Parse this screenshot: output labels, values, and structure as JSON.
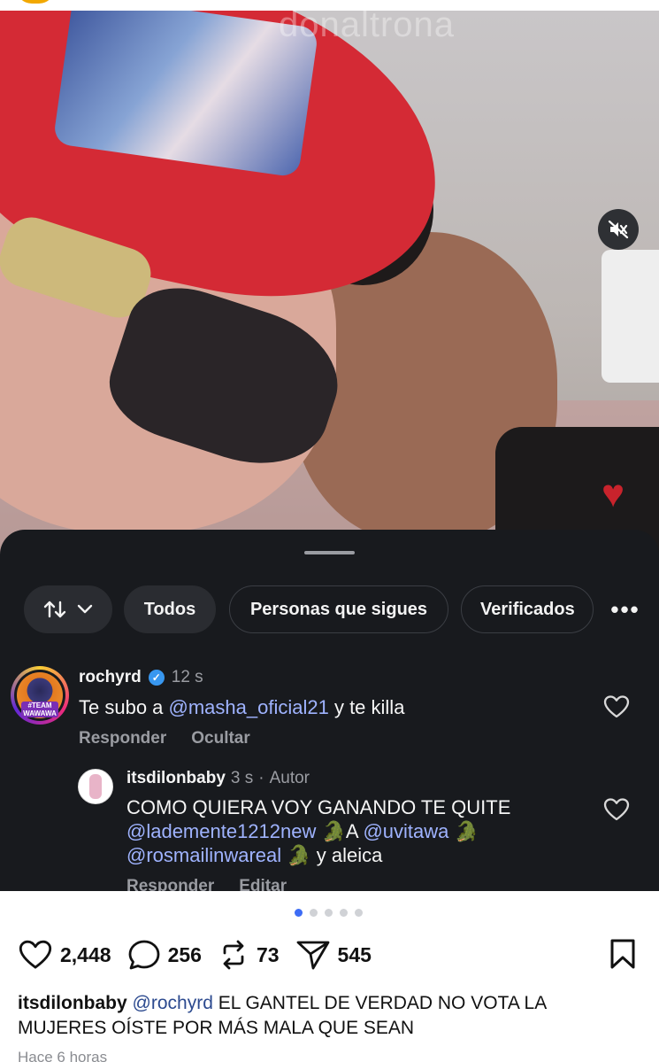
{
  "media": {
    "watermark": "donaltrona"
  },
  "filters": {
    "sort_label": "↓↑",
    "chips": [
      "Todos",
      "Personas que sigues",
      "Verificados"
    ],
    "more": "•••"
  },
  "comments": [
    {
      "username": "rochyrd",
      "time": "12 s",
      "text_prefix": "Te subo a ",
      "mention": "@masha_oficial21",
      "text_suffix": " y te killa",
      "reply": "Responder",
      "hide": "Ocultar",
      "avatar_tag": "#TEAM WAWAWA"
    },
    {
      "username": "itsdilonbaby",
      "time": "3 s",
      "author": "Autor",
      "line1": "COMO QUIERA VOY GANANDO TE QUITE",
      "mention1": "@lademente1212new",
      "mid1": " 🐊A ",
      "mention2": "@uvitawa",
      "mid2": " 🐊",
      "mention3": "@rosmailinwareal",
      "line3_suffix": " 🐊 y aleica",
      "reply": "Responder",
      "edit": "Editar"
    }
  ],
  "post": {
    "likes": "2,448",
    "comments": "256",
    "reposts": "73",
    "shares": "545",
    "caption_user": "itsdilonbaby",
    "caption_mention": "@rochyrd",
    "caption_text": " EL GANTEL DE VERDAD NO VOTA LA MUJERES OÍSTE POR MÁS MALA QUE SEAN",
    "timestamp": "Hace 6 horas"
  },
  "carousel": {
    "count": 5,
    "active": 0
  },
  "colors": {
    "sheet": "#181a1e",
    "mention": "#9fb3ff",
    "heart": "#c8232c",
    "dot_active": "#3d6cf5"
  }
}
